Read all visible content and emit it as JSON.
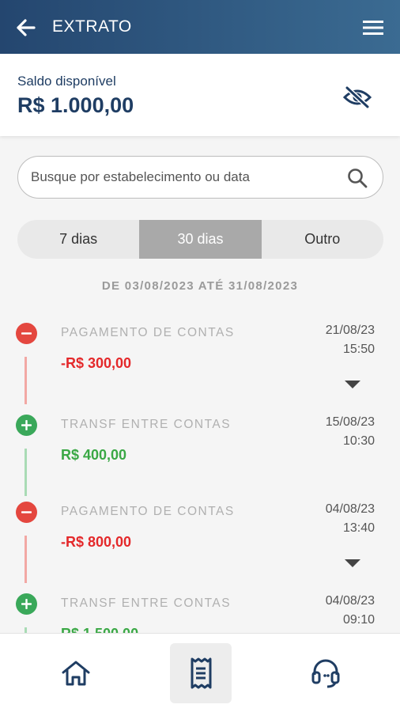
{
  "header": {
    "title": "EXTRATO",
    "back_icon": "arrow-left-icon",
    "menu_icon": "hamburger-menu-icon"
  },
  "balance": {
    "label": "Saldo disponível",
    "value": "R$ 1.000,00",
    "toggle_icon": "eye-off-icon"
  },
  "search": {
    "placeholder": "Busque por estabelecimento ou data",
    "value": "",
    "icon": "search-icon"
  },
  "period_tabs": {
    "items": [
      "7 dias",
      "30 dias",
      "Outro"
    ],
    "selected": "30 dias"
  },
  "date_range": "DE 03/08/2023 ATÉ 31/08/2023",
  "transactions": [
    {
      "type": "debit",
      "description": "PAGAMENTO DE CONTAS",
      "amount": "-R$ 300,00",
      "date": "21/08/23",
      "time": "15:50",
      "expandable": true
    },
    {
      "type": "credit",
      "description": "TRANSF ENTRE CONTAS",
      "amount": "R$ 400,00",
      "date": "15/08/23",
      "time": "10:30",
      "expandable": false
    },
    {
      "type": "debit",
      "description": "PAGAMENTO DE CONTAS",
      "amount": "-R$ 800,00",
      "date": "04/08/23",
      "time": "13:40",
      "expandable": true
    },
    {
      "type": "credit",
      "description": "TRANSF ENTRE CONTAS",
      "amount": "R$ 1.500,00",
      "date": "04/08/23",
      "time": "09:10",
      "expandable": false
    }
  ],
  "bottom_nav": {
    "items": [
      "home-icon",
      "receipt-icon",
      "headset-icon"
    ],
    "active": "receipt-icon"
  },
  "colors": {
    "header_start": "#24466f",
    "header_end": "#3b6b92",
    "debit": "#e4282a",
    "credit": "#3aa845",
    "brand_text": "#1f3d63"
  }
}
